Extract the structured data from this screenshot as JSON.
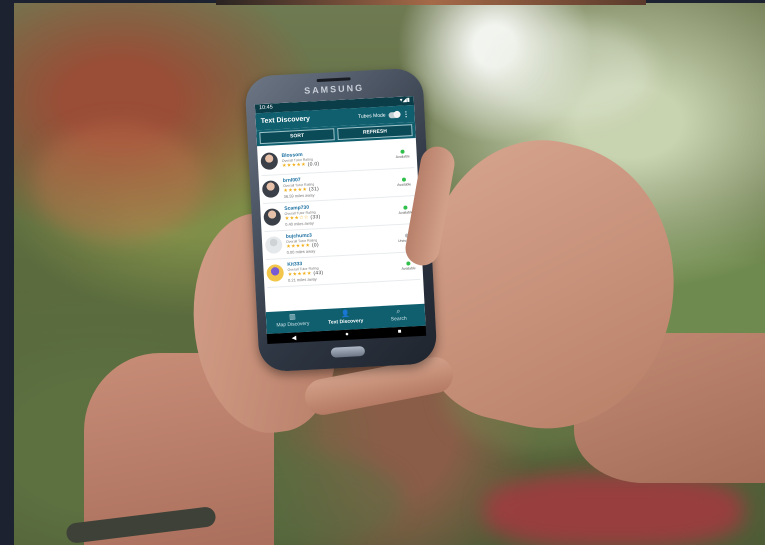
{
  "scene": {
    "subject": "hands-holding-phone",
    "palette": {
      "background": "#1d2230",
      "app_bar": "#0f5f6f",
      "available": "#2fbf4a",
      "red_sleeve": "#b03442"
    }
  },
  "phone": {
    "brand": "SAMSUNG",
    "status_time": "10:45",
    "status_icons": "▾◢▮",
    "app": {
      "title": "Text Discovery",
      "tubes_mode_label": "Tubes Mode",
      "menu_icon": "⋮",
      "sort_label": "SORT",
      "refresh_label": "REFRESH",
      "rating_label": "Overall Tutor Rating",
      "users": [
        {
          "name": "Blossom",
          "stars": "★★★★★",
          "count": "(0.0)",
          "distance": "",
          "status": "Available",
          "available": true,
          "avatar": "photo"
        },
        {
          "name": "brnl007",
          "stars": "★★★★★",
          "count": "(31)",
          "distance": "36.59 miles away",
          "status": "Available",
          "available": true,
          "avatar": "photo"
        },
        {
          "name": "Scamp730",
          "stars": "★★★☆☆",
          "count": "(33)",
          "distance": "0.40 miles away",
          "status": "Available",
          "available": true,
          "avatar": "photo"
        },
        {
          "name": "bujchumz3",
          "stars": "★★★★★",
          "count": "(0)",
          "distance": "0.00 miles away",
          "status": "Unavailable",
          "available": false,
          "avatar": "blank"
        },
        {
          "name": "Kit333",
          "stars": "★★★★★",
          "count": "(43)",
          "distance": "0.21 miles away",
          "status": "Available",
          "available": true,
          "avatar": "yellow"
        }
      ],
      "nav": {
        "map_label": "Map Discovery",
        "text_label": "Text Discovery",
        "search_label": "Search",
        "map_icon": "map-icon",
        "text_icon": "person-icon",
        "search_icon": "search-icon"
      },
      "system_buttons": {
        "back": "◀",
        "home": "●",
        "recents": "■"
      }
    }
  }
}
